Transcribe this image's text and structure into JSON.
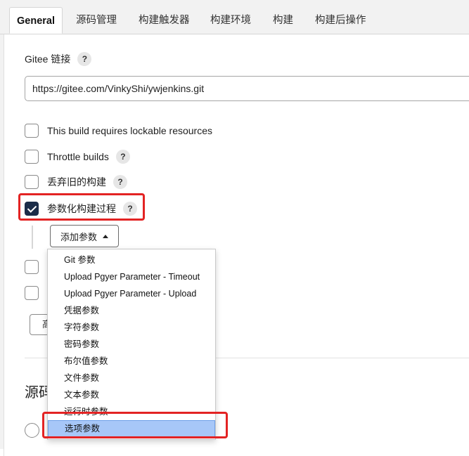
{
  "tabs": [
    "General",
    "源码管理",
    "构建触发器",
    "构建环境",
    "构建",
    "构建后操作"
  ],
  "active_tab": "General",
  "gitee": {
    "label": "Gitee 链接",
    "help": "?",
    "url": "https://gitee.com/VinkyShi/ywjenkins.git"
  },
  "options": [
    {
      "label": "This build requires lockable resources",
      "checked": false,
      "help": ""
    },
    {
      "label": "Throttle builds",
      "checked": false,
      "help": "?"
    },
    {
      "label": "丢弃旧的构建",
      "checked": false,
      "help": "?"
    },
    {
      "label": "参数化构建过程",
      "checked": true,
      "help": "?"
    }
  ],
  "add_param_button": "添加参数",
  "param_menu": {
    "items": [
      "Git 参数",
      "Upload Pgyer Parameter - Timeout",
      "Upload Pgyer Parameter - Upload",
      "凭据参数",
      "字符参数",
      "密码参数",
      "布尔值参数",
      "文件参数",
      "文本参数",
      "运行时参数",
      "选项参数"
    ],
    "selected": "选项参数"
  },
  "advanced_button": "高级",
  "section_title": "源码管理",
  "colors": {
    "highlight": "#e32323",
    "checkbox_checked": "#1b2c48",
    "menu_selected": "#a7c7f8"
  }
}
